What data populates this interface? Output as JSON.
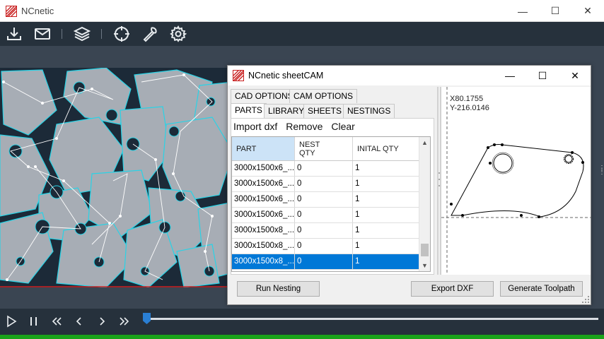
{
  "app": {
    "title": "NCnetic"
  },
  "toolbar": {
    "icons": [
      "download-icon",
      "mail-icon",
      "layers-icon",
      "crosshair-icon",
      "wrench-icon",
      "gear-icon"
    ]
  },
  "dialog": {
    "title": "NCnetic sheetCAM",
    "tabs_row1": [
      "CAD OPTIONS",
      "CAM OPTIONS"
    ],
    "tabs_row2": [
      "PARTS",
      "LIBRARY",
      "SHEETS",
      "NESTINGS"
    ],
    "active_tab": "PARTS",
    "menu": {
      "import": "Import dxf",
      "remove": "Remove",
      "clear": "Clear"
    },
    "table": {
      "headers": {
        "part": "PART",
        "nest_qty_1": "NEST",
        "nest_qty_2": "QTY",
        "initial_qty": "INITAL QTY"
      },
      "rows": [
        {
          "part": "3000x1500x6_...",
          "nest": "0",
          "init": "1"
        },
        {
          "part": "3000x1500x6_...",
          "nest": "0",
          "init": "1"
        },
        {
          "part": "3000x1500x6_...",
          "nest": "0",
          "init": "1"
        },
        {
          "part": "3000x1500x6_...",
          "nest": "0",
          "init": "1"
        },
        {
          "part": "3000x1500x8_...",
          "nest": "0",
          "init": "1"
        },
        {
          "part": "3000x1500x8_...",
          "nest": "0",
          "init": "1"
        },
        {
          "part": "3000x1500x8_...",
          "nest": "0",
          "init": "1"
        }
      ],
      "selected_row": 6
    },
    "buttons": {
      "run": "Run Nesting",
      "export": "Export DXF",
      "generate": "Generate Toolpath"
    },
    "preview": {
      "x": "X80.1755",
      "y": "Y-216.0146"
    }
  },
  "colors": {
    "accent": "#0078d7",
    "part_outline": "#29d3e6",
    "status": "#1aa31a"
  }
}
